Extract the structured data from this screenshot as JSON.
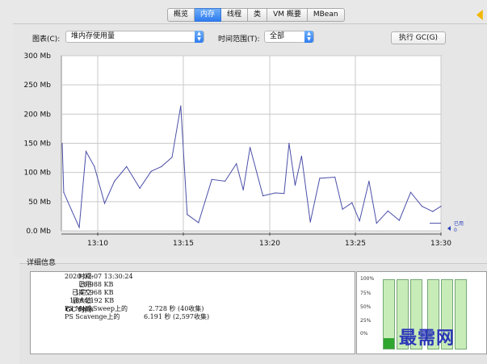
{
  "tabs": [
    "概览",
    "内存",
    "线程",
    "类",
    "VM 概要",
    "MBean"
  ],
  "active_tab": "内存",
  "controls": {
    "chart_label": "图表(C):",
    "chart_value": "堆内存使用量",
    "range_label": "时间范围(T):",
    "range_value": "全部",
    "gc_button": "执行 GC(G)"
  },
  "chart_data": {
    "type": "line",
    "y_ticks": [
      "300 Mb",
      "250 Mb",
      "200 Mb",
      "150 Mb",
      "100 Mb",
      "50 Mb",
      "0.0 Mb"
    ],
    "x_ticks": [
      "13:10",
      "13:15",
      "13:20",
      "13:25",
      "13:30"
    ],
    "ylim": [
      0,
      300
    ],
    "xlim": [
      0,
      1
    ],
    "legend": {
      "name": "已用",
      "value": "0"
    },
    "series": [
      {
        "x": [
          0,
          0.004,
          0.025,
          0.045,
          0.063,
          0.085,
          0.112,
          0.138,
          0.17,
          0.205,
          0.235,
          0.262,
          0.29,
          0.313,
          0.33,
          0.36,
          0.395,
          0.43,
          0.46,
          0.478,
          0.496,
          0.53,
          0.563,
          0.586,
          0.599,
          0.615,
          0.632,
          0.655,
          0.68,
          0.72,
          0.74,
          0.765,
          0.785,
          0.81,
          0.83,
          0.86,
          0.89,
          0.92,
          0.95,
          0.978,
          1.0
        ],
        "y": [
          150,
          66,
          35,
          6,
          136,
          110,
          47,
          85,
          110,
          73,
          102,
          110,
          126,
          214,
          28,
          14,
          88,
          85,
          115,
          70,
          143,
          60,
          65,
          64,
          150,
          78,
          128,
          15,
          90,
          92,
          37,
          48,
          17,
          85,
          13,
          34,
          18,
          66,
          42,
          33,
          42
        ]
      }
    ]
  },
  "details": {
    "title": "详细信息",
    "rows": [
      {
        "key": "时间:",
        "value": "2020-02-07 13:30:24"
      },
      {
        "key": "已用:",
        "value": "28,988 KB"
      },
      {
        "key": "已提交:",
        "value": "147,968 KB"
      },
      {
        "key": "最大值:",
        "value": "1,864,192 KB"
      },
      {
        "key": "GC 时间:",
        "value": "PS MarkSweep上的",
        "value2": "2.728 秒 (40收集)"
      },
      {
        "key": "",
        "value": "PS Scavenge上的",
        "value2": "6.191 秒 (2,597收集)"
      }
    ]
  },
  "pool_chart": {
    "pct_labels": [
      "100%",
      "75%",
      "50%",
      "25%",
      "0%"
    ],
    "bars": [
      0.15,
      0.0,
      0.0,
      0.0,
      0.0,
      0.0
    ]
  },
  "watermark": "最需网"
}
